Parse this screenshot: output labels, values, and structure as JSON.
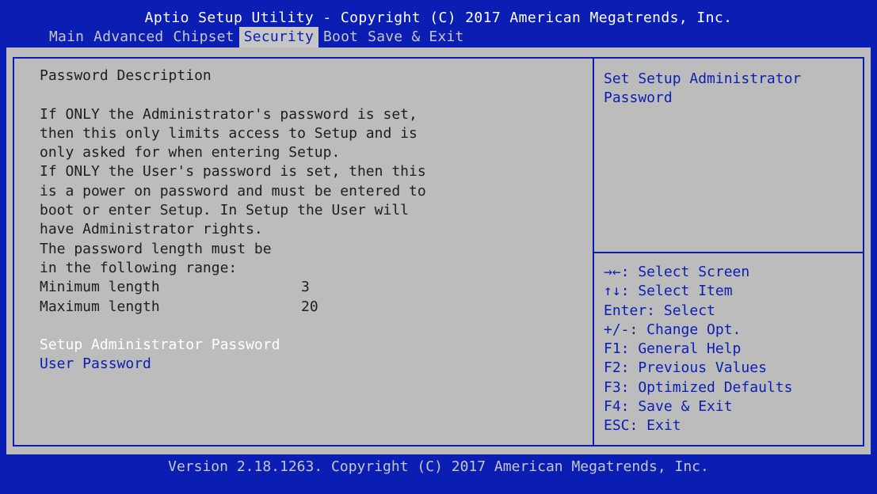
{
  "header": {
    "title": "Aptio Setup Utility - Copyright (C) 2017 American Megatrends, Inc.",
    "tabs": [
      {
        "label": "Main"
      },
      {
        "label": "Advanced"
      },
      {
        "label": "Chipset"
      },
      {
        "label": "Security"
      },
      {
        "label": "Boot"
      },
      {
        "label": "Save & Exit"
      }
    ],
    "active_tab": "Security"
  },
  "main": {
    "heading": "Password Description",
    "description": [
      "If ONLY the Administrator's password is set,",
      "then this only limits access to Setup and is",
      "only asked for when entering Setup.",
      "If ONLY the User's password is set, then this",
      "is a power on password and must be entered to",
      "boot or enter Setup. In Setup the User will",
      "have Administrator rights.",
      "The password length must be",
      "in the following range:"
    ],
    "min_label": "Minimum length",
    "min_value": "3",
    "max_label": "Maximum length",
    "max_value": "20",
    "items": [
      {
        "label": "Setup Administrator Password",
        "selected": true
      },
      {
        "label": "User Password",
        "selected": false
      }
    ]
  },
  "help": {
    "text": "Set Setup Administrator\nPassword"
  },
  "keys": [
    "→←: Select Screen",
    "↑↓: Select Item",
    "Enter: Select",
    "+/-: Change Opt.",
    "F1: General Help",
    "F2: Previous Values",
    "F3: Optimized Defaults",
    "F4: Save & Exit",
    "ESC: Exit"
  ],
  "footer": {
    "version": "Version 2.18.1263. Copyright (C) 2017 American Megatrends, Inc."
  },
  "colors": {
    "background": "#0a1eb4",
    "panel": "#bcbcbc",
    "text_dark": "#1e1e1e",
    "highlight": "#ffffff",
    "tab_text": "#c6c6c6"
  }
}
